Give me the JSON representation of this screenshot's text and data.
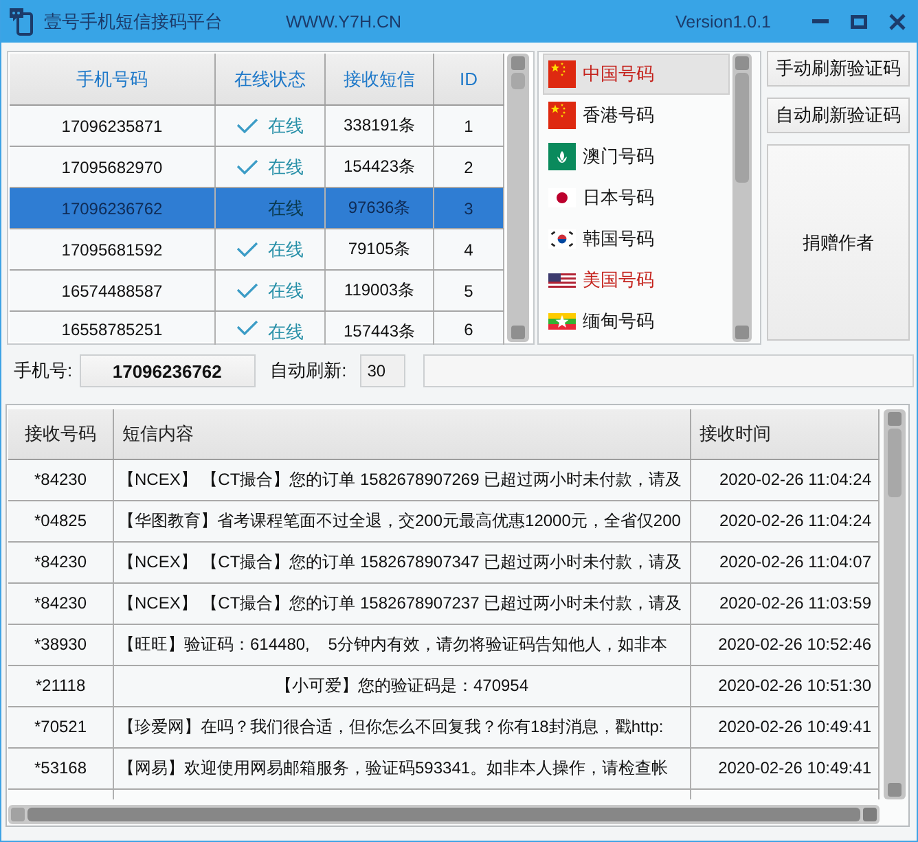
{
  "window": {
    "title": "壹号手机短信接码平台",
    "website": "WWW.Y7H.CN",
    "version": "Version1.0.1"
  },
  "number_table": {
    "columns": [
      "手机号码",
      "在线状态",
      "接收短信",
      "ID"
    ],
    "rows": [
      {
        "phone": "17096235871",
        "status": "在线",
        "received": "338191条",
        "id": "1",
        "selected": false
      },
      {
        "phone": "17095682970",
        "status": "在线",
        "received": "154423条",
        "id": "2",
        "selected": false
      },
      {
        "phone": "17096236762",
        "status": "在线",
        "received": "97636条",
        "id": "3",
        "selected": true
      },
      {
        "phone": "17095681592",
        "status": "在线",
        "received": "79105条",
        "id": "4",
        "selected": false
      },
      {
        "phone": "16574488587",
        "status": "在线",
        "received": "119003条",
        "id": "5",
        "selected": false
      },
      {
        "phone": "16558785251",
        "status": "在线",
        "received": "157443条",
        "id": "6",
        "selected": false
      }
    ]
  },
  "country_list": [
    {
      "label": "中国号码",
      "kind": "cn",
      "selected": true,
      "color": "#c4211b"
    },
    {
      "label": "香港号码",
      "kind": "hk",
      "selected": false,
      "color": "#151515"
    },
    {
      "label": "澳门号码",
      "kind": "mo",
      "selected": false,
      "color": "#151515"
    },
    {
      "label": "日本号码",
      "kind": "jp",
      "selected": false,
      "color": "#151515"
    },
    {
      "label": "韩国号码",
      "kind": "kr",
      "selected": false,
      "color": "#151515"
    },
    {
      "label": "美国号码",
      "kind": "us",
      "selected": false,
      "color": "#c4211b"
    },
    {
      "label": "缅甸号码",
      "kind": "mm",
      "selected": false,
      "color": "#151515"
    }
  ],
  "side_buttons": [
    {
      "label": "手动刷新验证码",
      "kind": "small"
    },
    {
      "label": "自动刷新验证码",
      "kind": "small"
    },
    {
      "label": "捐赠作者",
      "kind": "large"
    }
  ],
  "phone_bar": {
    "phone_label": "手机号:",
    "phone_value": "17096236762",
    "refresh_label": "自动刷新:",
    "refresh_value": "30"
  },
  "messages": {
    "columns": [
      "接收号码",
      "短信内容",
      "接收时间"
    ],
    "rows": [
      {
        "sender": "*84230",
        "content": "【NCEX】 【CT撮合】您的订单 1582678907269 已超过两小时未付款，请及",
        "time": "2020-02-26 11:04:24",
        "centered": false
      },
      {
        "sender": "*04825",
        "content": "【华图教育】省考课程笔面不过全退，交200元最高优惠12000元，全省仅200",
        "time": "2020-02-26 11:04:24",
        "centered": false
      },
      {
        "sender": "*84230",
        "content": "【NCEX】 【CT撮合】您的订单 1582678907347 已超过两小时未付款，请及",
        "time": "2020-02-26 11:04:07",
        "centered": false
      },
      {
        "sender": "*84230",
        "content": "【NCEX】 【CT撮合】您的订单 1582678907237 已超过两小时未付款，请及",
        "time": "2020-02-26 11:03:59",
        "centered": false
      },
      {
        "sender": "*38930",
        "content": "【旺旺】验证码：614480,    5分钟内有效，请勿将验证码告知他人，如非本",
        "time": "2020-02-26 10:52:46",
        "centered": false
      },
      {
        "sender": "*21118",
        "content": "【小可爱】您的验证码是：470954",
        "time": "2020-02-26 10:51:30",
        "centered": true
      },
      {
        "sender": "*70521",
        "content": "【珍爱网】在吗？我们很合适，但你怎么不回复我？你有18封消息，戳http:",
        "time": "2020-02-26 10:49:41",
        "centered": false
      },
      {
        "sender": "*53168",
        "content": "【网易】欢迎使用网易邮箱服务，验证码593341。如非本人操作，请检查帐",
        "time": "2020-02-26 10:49:41",
        "centered": false
      }
    ]
  }
}
